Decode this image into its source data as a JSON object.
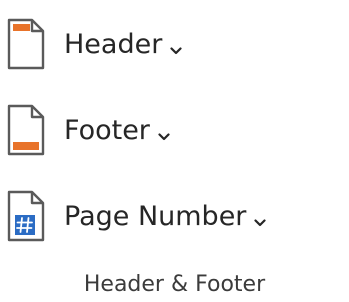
{
  "ribbon_group": {
    "commands": [
      {
        "label": "Header",
        "icon": "header-icon",
        "has_dropdown": true
      },
      {
        "label": "Footer",
        "icon": "footer-icon",
        "has_dropdown": true
      },
      {
        "label": "Page Number",
        "icon": "page-number-icon",
        "has_dropdown": true
      }
    ],
    "group_label": "Header & Footer"
  },
  "colors": {
    "accent_orange": "#E8732A",
    "accent_blue": "#2B6CC4",
    "page_outline": "#5A5A5A",
    "text": "#262626"
  }
}
